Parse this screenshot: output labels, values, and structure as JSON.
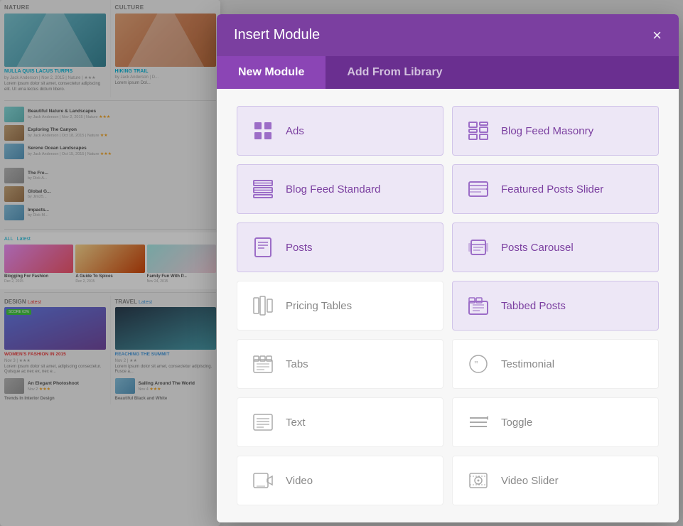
{
  "modal": {
    "title": "Insert Module",
    "close_label": "×",
    "tabs": [
      {
        "id": "new",
        "label": "New Module",
        "active": true
      },
      {
        "id": "library",
        "label": "Add From Library",
        "active": false
      }
    ],
    "modules": [
      {
        "id": "ads",
        "label": "Ads",
        "icon": "grid-icon",
        "purple": true
      },
      {
        "id": "blog-feed-masonry",
        "label": "Blog Feed Masonry",
        "icon": "masonry-icon",
        "purple": true
      },
      {
        "id": "blog-feed-standard",
        "label": "Blog Feed Standard",
        "icon": "list-icon",
        "purple": true
      },
      {
        "id": "featured-posts-slider",
        "label": "Featured Posts Slider",
        "icon": "slider-icon",
        "purple": true
      },
      {
        "id": "posts",
        "label": "Posts",
        "icon": "posts-icon",
        "purple": true
      },
      {
        "id": "posts-carousel",
        "label": "Posts Carousel",
        "icon": "carousel-icon",
        "purple": true
      },
      {
        "id": "pricing-tables",
        "label": "Pricing Tables",
        "icon": "pricing-icon",
        "purple": false
      },
      {
        "id": "tabbed-posts",
        "label": "Tabbed Posts",
        "icon": "tabbed-icon",
        "purple": true
      },
      {
        "id": "tabs",
        "label": "Tabs",
        "icon": "tabs-icon",
        "purple": false
      },
      {
        "id": "testimonial",
        "label": "Testimonial",
        "icon": "testimonial-icon",
        "purple": false
      },
      {
        "id": "text",
        "label": "Text",
        "icon": "text-icon",
        "purple": false
      },
      {
        "id": "toggle",
        "label": "Toggle",
        "icon": "toggle-icon",
        "purple": false
      },
      {
        "id": "video",
        "label": "Video",
        "icon": "video-icon",
        "purple": false
      },
      {
        "id": "video-slider",
        "label": "Video Slider",
        "icon": "video-slider-icon",
        "purple": false
      }
    ]
  },
  "blog": {
    "nature_label": "NATURE",
    "culture_label": "CULTURE",
    "all_latest": "ALL",
    "all_latest_sub": "Latest",
    "design_label": "DESIGN",
    "design_sub": "Latest",
    "travel_label": "TRAVEL",
    "travel_sub": "Latest",
    "post1_title": "NULLA QUIS LACUS TURPIS",
    "post1_meta": "by Jack Anderson | Nov 2, 2015 | Nature | ★★★",
    "post1_text": "Lorem ipsum dolor sit amet, consectetur adipiscing elit. Ut urna lectus dictum libero.",
    "post2_title": "HIKING TRAIL",
    "post2_meta": "by Jack Anderson | D...",
    "latest1_title": "Blogging For Fashion",
    "latest1_date": "Dec 2, 2015",
    "latest2_title": "A Guide To Spices",
    "latest2_date": "Dec 2, 2015",
    "latest3_title": "Family Fun With P...",
    "latest3_date": "Nov 24, 2015",
    "design_post_title": "WOMEN'S FASHION IN 2015",
    "travel_post_title": "REACHING THE SUMMIT"
  }
}
